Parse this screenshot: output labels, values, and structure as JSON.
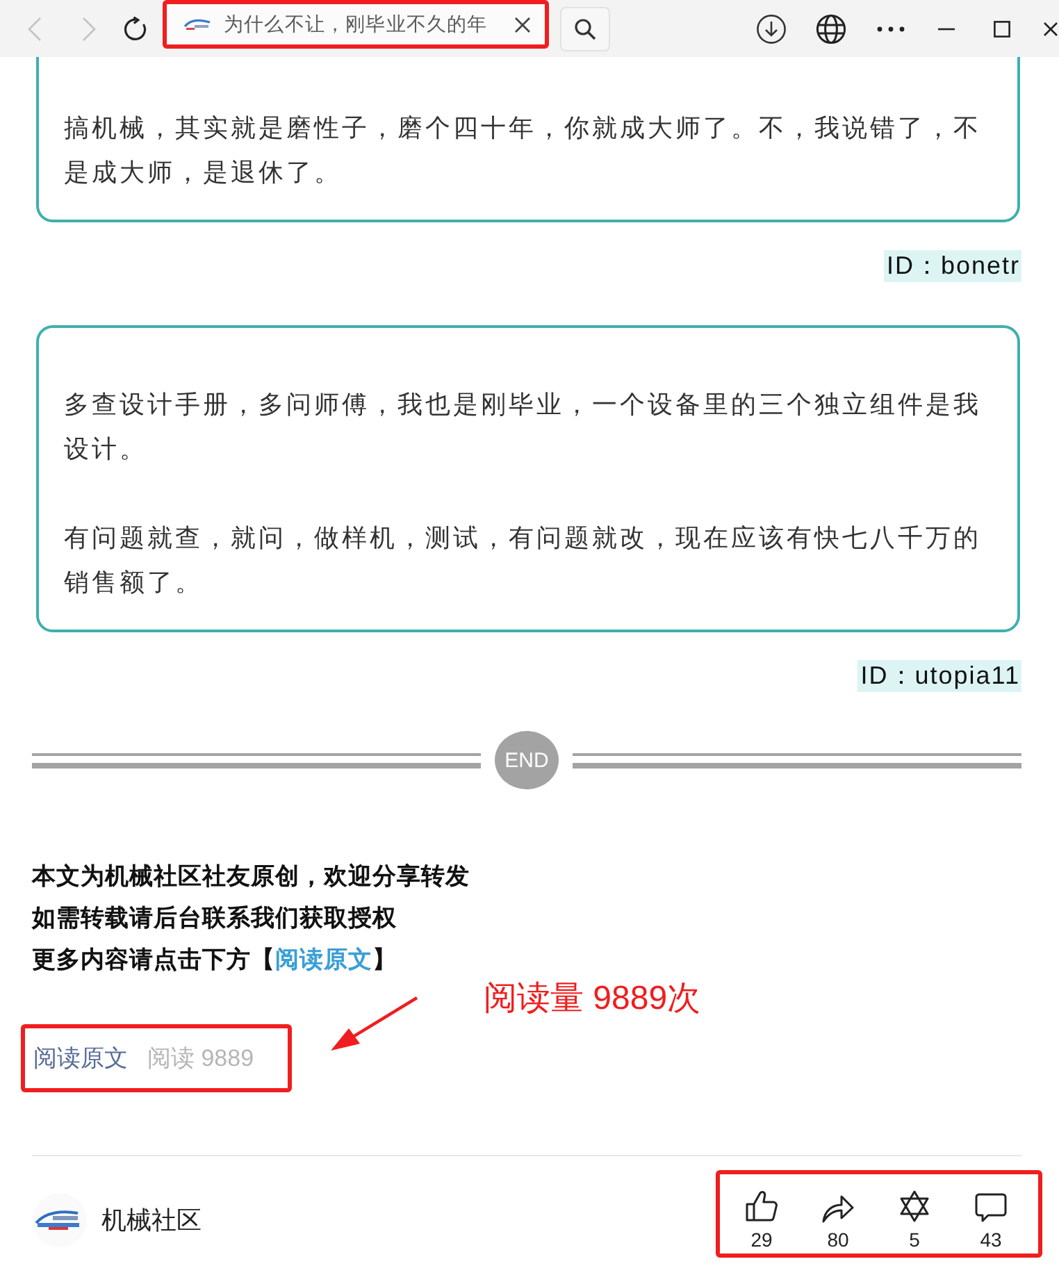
{
  "browser": {
    "back": {
      "disabled": true
    },
    "forward": {
      "disabled": true
    },
    "address": {
      "title": "为什么不让，刚毕业不久的年",
      "highlighted": true
    }
  },
  "comments": [
    {
      "paragraphs": [
        "搞机械，其实就是磨性子，磨个四十年，你就成大师了。不，我说错了，不是成大师，是退休了。"
      ],
      "author": "ID：bonetr"
    },
    {
      "paragraphs": [
        "多查设计手册，多问师傅，我也是刚毕业，一个设备里的三个独立组件是我设计。",
        "有问题就查，就问，做样机，测试，有问题就改，现在应该有快七八千万的销售额了。"
      ],
      "author": "ID：utopia11"
    }
  ],
  "end_mark": "END",
  "notice": {
    "lines": [
      {
        "kind": "plain",
        "text": "本文为机械社区社友原创，欢迎分享转发"
      },
      {
        "kind": "plain",
        "text": "如需转载请后台联系我们获取授权"
      },
      {
        "kind": "link",
        "before": "更多内容请点击下方【",
        "link": "阅读原文",
        "after": "】"
      }
    ]
  },
  "annotation": {
    "text": "阅读量 9889次"
  },
  "read_stats": {
    "highlighted": true,
    "link": "阅读原文",
    "count": "阅读 9889"
  },
  "account": {
    "name": "机械社区"
  },
  "actions": {
    "highlighted": true,
    "items": [
      {
        "kind": "like",
        "count": "29"
      },
      {
        "kind": "share",
        "count": "80"
      },
      {
        "kind": "wow",
        "count": "5"
      },
      {
        "kind": "comment",
        "count": "43"
      }
    ]
  }
}
